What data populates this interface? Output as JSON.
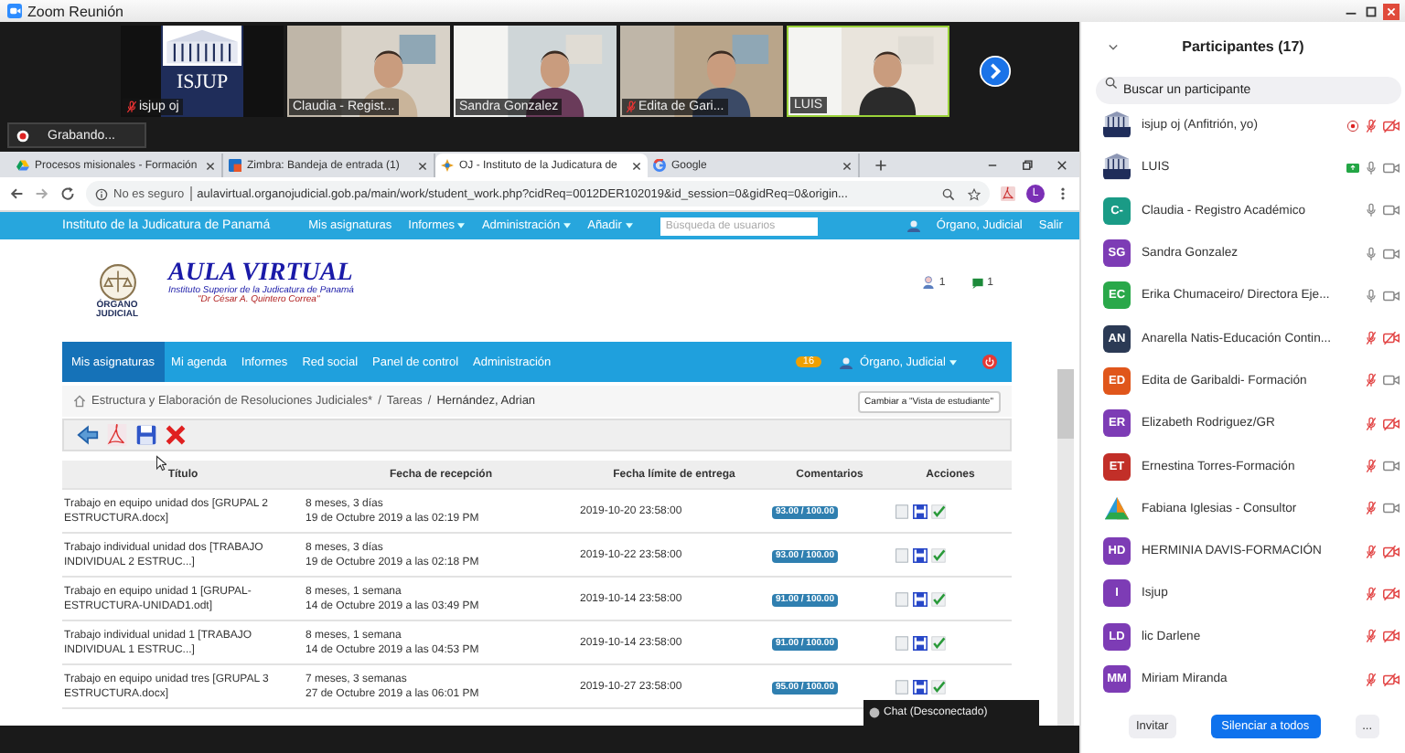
{
  "window": {
    "title": "Zoom Reunión"
  },
  "video_tiles": [
    {
      "name": "isjup oj",
      "kind": "logo",
      "logo_text": "ISJUP",
      "muted": true,
      "speaking": false
    },
    {
      "name": "Claudia - Regist...",
      "kind": "video",
      "muted": false,
      "speaking": false
    },
    {
      "name": "Sandra Gonzalez",
      "kind": "video",
      "muted": false,
      "speaking": false
    },
    {
      "name": "Edita de Gari...",
      "kind": "video",
      "muted": true,
      "speaking": false
    },
    {
      "name": "LUIS",
      "kind": "video",
      "muted": false,
      "speaking": true
    }
  ],
  "recording": {
    "label": "Grabando..."
  },
  "browser": {
    "tabs": [
      {
        "title": "Procesos misionales - Formación",
        "selected": false
      },
      {
        "title": "Zimbra: Bandeja de entrada (1)",
        "selected": false
      },
      {
        "title": "OJ - Instituto de la Judicatura de",
        "selected": true
      },
      {
        "title": "Google",
        "selected": false
      }
    ],
    "security": "No es seguro",
    "url": "aulavirtual.organojudicial.gob.pa/main/work/student_work.php?cidReq=0012DER102019&id_session=0&gidReq=0&origin...",
    "profile": "L"
  },
  "site": {
    "top_bar": {
      "brand": "Instituto de la Judicatura de Panamá",
      "menu": [
        {
          "label": "Mis asignaturas",
          "dropdown": false
        },
        {
          "label": "Informes",
          "dropdown": true
        },
        {
          "label": "Administración",
          "dropdown": true
        },
        {
          "label": "Añadir",
          "dropdown": true
        }
      ],
      "search_placeholder": "Búsqueda de usuarios",
      "user": "Órgano, Judicial",
      "logout": "Salir"
    },
    "header": {
      "logo_lines": [
        "ÓRGANO",
        "JUDICIAL"
      ],
      "title": "AULA VIRTUAL",
      "subtitle": "Instituto Superior de la Judicatura de Panamá",
      "tagline": "\"Dr César A. Quintero Correa\"",
      "users_count": "1",
      "messages_count": "1"
    },
    "nav": {
      "items": [
        {
          "label": "Mis asignaturas",
          "selected": true
        },
        {
          "label": "Mi agenda",
          "selected": false
        },
        {
          "label": "Informes",
          "selected": false
        },
        {
          "label": "Red social",
          "selected": false
        },
        {
          "label": "Panel de control",
          "selected": false
        },
        {
          "label": "Administración",
          "selected": false
        }
      ],
      "badge": "16",
      "user": "Órgano, Judicial"
    },
    "breadcrumb": [
      "Estructura y Elaboración de Resoluciones Judiciales*",
      "/",
      "Tareas",
      "/",
      "Hernández, Adrian"
    ],
    "student_view_button": "Cambiar a \"Vista de estudiante\"",
    "table": {
      "columns": [
        "Título",
        "Fecha de recepción",
        "Fecha límite de entrega",
        "Comentarios",
        "Acciones"
      ],
      "rows": [
        {
          "title": "Trabajo en equipo unidad dos [GRUPAL 2 ESTRUCTURA.docx]",
          "age": "8 meses, 3 días",
          "received": "19 de Octubre 2019 a las 02:19 PM",
          "deadline": "2019-10-20 23:58:00",
          "score": "93.00 / 100.00"
        },
        {
          "title": "Trabajo individual unidad dos [TRABAJO INDIVIDUAL 2 ESTRUC...]",
          "age": "8 meses, 3 días",
          "received": "19 de Octubre 2019 a las 02:18 PM",
          "deadline": "2019-10-22 23:58:00",
          "score": "93.00 / 100.00"
        },
        {
          "title": "Trabajo en equipo unidad 1 [GRUPAL-ESTRUCTURA-UNIDAD1.odt]",
          "age": "8 meses, 1 semana",
          "received": "14 de Octubre 2019 a las 03:49 PM",
          "deadline": "2019-10-14 23:58:00",
          "score": "91.00 / 100.00"
        },
        {
          "title": "Trabajo individual unidad 1 [TRABAJO INDIVIDUAL 1 ESTRUC...]",
          "age": "8 meses, 1 semana",
          "received": "14 de Octubre 2019 a las 04:53 PM",
          "deadline": "2019-10-14 23:58:00",
          "score": "91.00 / 100.00"
        },
        {
          "title": "Trabajo en equipo unidad tres [GRUPAL 3 ESTRUCTURA.docx]",
          "age": "7 meses, 3 semanas",
          "received": "27 de Octubre 2019 a las 06:01 PM",
          "deadline": "2019-10-27 23:58:00",
          "score": "95.00 / 100.00"
        }
      ]
    }
  },
  "chat": {
    "label": "Chat (Desconectado)"
  },
  "participants": {
    "title": "Participantes (17)",
    "search_placeholder": "Buscar un participante",
    "list": [
      {
        "name": "isjup oj (Anfitrión, yo)",
        "kind": "logo",
        "recording": true,
        "sharing": false,
        "muted": true,
        "video_off": true
      },
      {
        "name": "LUIS",
        "kind": "logo",
        "recording": false,
        "sharing": true,
        "muted": false,
        "video_off": false
      },
      {
        "name": "Claudia - Registro Académico",
        "kind": "initials",
        "initials": "C-",
        "color": "#1a9b86",
        "recording": false,
        "sharing": false,
        "muted": false,
        "video_off": false
      },
      {
        "name": "Sandra Gonzalez",
        "kind": "initials",
        "initials": "SG",
        "color": "#7d3cb5",
        "recording": false,
        "sharing": false,
        "muted": false,
        "video_off": false
      },
      {
        "name": "Erika Chumaceiro/ Directora Eje...",
        "kind": "initials",
        "initials": "EC",
        "color": "#2aa84a",
        "recording": false,
        "sharing": false,
        "muted": false,
        "video_off": false
      },
      {
        "name": "Anarella Natis-Educación Contin...",
        "kind": "initials",
        "initials": "AN",
        "color": "#2b3a55",
        "recording": false,
        "sharing": false,
        "muted": true,
        "video_off": true
      },
      {
        "name": "Edita de Garibaldi- Formación",
        "kind": "initials",
        "initials": "ED",
        "color": "#e0561b",
        "recording": false,
        "sharing": false,
        "muted": true,
        "video_off": false
      },
      {
        "name": "Elizabeth Rodriguez/GR",
        "kind": "initials",
        "initials": "ER",
        "color": "#7d3cb5",
        "recording": false,
        "sharing": false,
        "muted": true,
        "video_off": true
      },
      {
        "name": "Ernestina Torres-Formación",
        "kind": "initials",
        "initials": "ET",
        "color": "#c22f28",
        "recording": false,
        "sharing": false,
        "muted": true,
        "video_off": false
      },
      {
        "name": "Fabiana Iglesias - Consultor",
        "recording": false,
        "sharing": false,
        "muted": true,
        "video_off": false
      },
      {
        "name": "HERMINIA DAVIS-FORMACIÓN",
        "kind": "initials",
        "initials": "HD",
        "color": "#7d3cb5",
        "recording": false,
        "sharing": false,
        "muted": true,
        "video_off": true
      },
      {
        "name": "Isjup",
        "kind": "initials",
        "initials": "I",
        "color": "#7d3cb5",
        "recording": false,
        "sharing": false,
        "muted": true,
        "video_off": true
      },
      {
        "name": "lic Darlene",
        "kind": "initials",
        "initials": "LD",
        "color": "#7d3cb5",
        "recording": false,
        "sharing": false,
        "muted": true,
        "video_off": true
      },
      {
        "name": "Miriam Miranda",
        "kind": "initials",
        "initials": "MM",
        "color": "#7d3cb5",
        "recording": false,
        "sharing": false,
        "muted": true,
        "video_off": true
      }
    ],
    "buttons": [
      "Invitar",
      "Silenciar a todos",
      "..."
    ]
  }
}
